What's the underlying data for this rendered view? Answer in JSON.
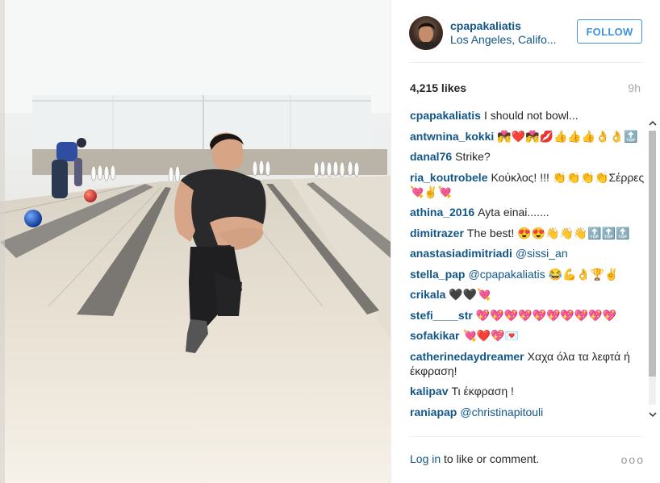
{
  "post": {
    "username": "cpapakaliatis",
    "location": "Los Angeles, Califo...",
    "follow_label": "FOLLOW",
    "likes": "4,215 likes",
    "age": "9h"
  },
  "comments": [
    {
      "user": "cpapakaliatis",
      "text": "I should not bowl..."
    },
    {
      "user": "antwnina_kokki",
      "text": "💏❤️💏💋👍👍👍👌👌🔝"
    },
    {
      "user": "danal76",
      "text": "Strike?"
    },
    {
      "user": "ria_koutrobele",
      "text": "Κούκλος! !!! 👏👏👏👏Σέρρες 💘✌️💘"
    },
    {
      "user": "athina_2016",
      "text": "Ayta einai.......",
      "mention": ""
    },
    {
      "user": "dimitrazer",
      "text": "The best! 😍😍👋👋👋🔝🔝🔝"
    },
    {
      "user": "anastasiadimitriadi",
      "text": "",
      "mention": "@sissi_an"
    },
    {
      "user": "stella_pap",
      "text": "😂💪👌🏆✌️",
      "mention": "@cpapakaliatis"
    },
    {
      "user": "crikala",
      "text": "🖤🖤💘"
    },
    {
      "user": "stefi____str",
      "text": "💖💖💖💖💖💖💖💖💖💖"
    },
    {
      "user": "sofakikar",
      "text": "💘❤️💖💌"
    },
    {
      "user": "catherinedaydreamer",
      "text": "Χαχα όλα τα λεφτά ή έκφραση!"
    },
    {
      "user": "kalipav",
      "text": "Τι έκφραση !"
    },
    {
      "user": "raniapap",
      "text": "",
      "mention": "@christinapitouli"
    }
  ],
  "footer": {
    "login_link": "Log in",
    "login_rest": " to like or comment.",
    "more": "ooo"
  },
  "icons": {
    "scroll_up": "chevron-up-icon",
    "scroll_down": "chevron-down-icon",
    "more": "more-options-icon"
  },
  "colors": {
    "link": "#125688",
    "follow": "#4090db",
    "muted": "#a5a7aa"
  }
}
